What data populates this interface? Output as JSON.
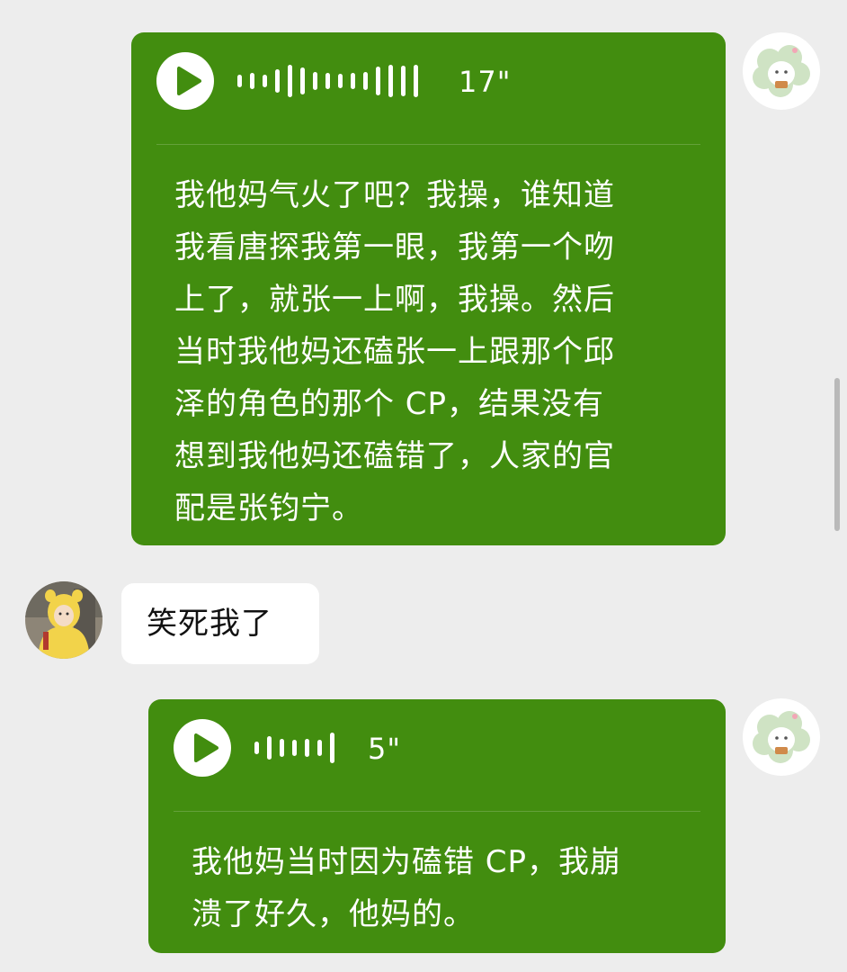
{
  "messages": [
    {
      "id": "voice1",
      "sender": "self",
      "type": "voice",
      "duration": "17\"",
      "transcript": "我他妈气火了吧？我操，谁知道\n我看唐探我第一眼，我第一个吻\n上了，就张一上啊，我操。然后\n当时我他妈还磕张一上跟那个邱\n泽的角色的那个 CP，结果没有\n想到我他妈还磕错了，人家的官\n配是张钧宁。",
      "avatar_icon": "cartoon-sheep-icon"
    },
    {
      "id": "text1",
      "sender": "other",
      "type": "text",
      "text": "笑死我了",
      "avatar_icon": "child-yellow-hoodie-photo"
    },
    {
      "id": "voice2",
      "sender": "self",
      "type": "voice",
      "duration": "5\"",
      "transcript": "我他妈当时因为磕错 CP，我崩\n溃了好久，他妈的。",
      "avatar_icon": "cartoon-sheep-icon"
    }
  ],
  "colors": {
    "background": "#ededed",
    "self_bubble": "#428d0f",
    "other_bubble": "#ffffff"
  }
}
